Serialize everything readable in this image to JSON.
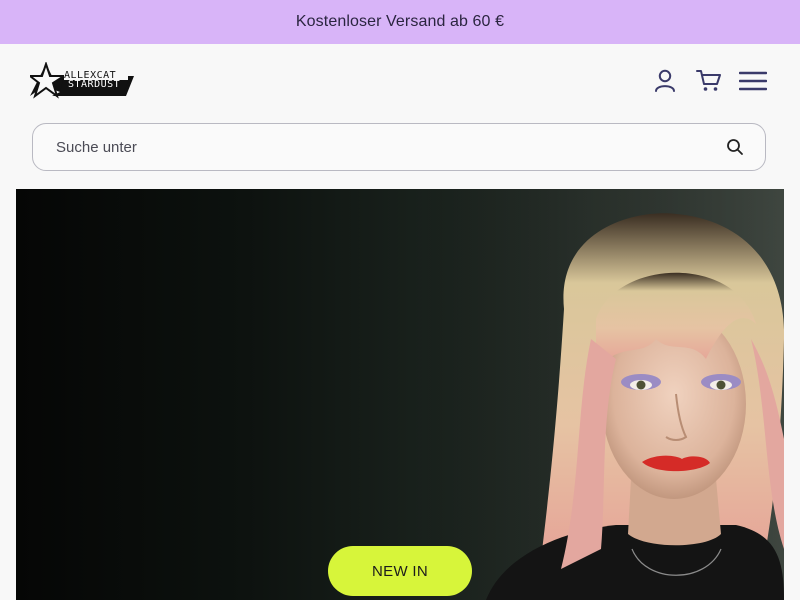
{
  "promo": {
    "text": "Kostenloser Versand ab 60 €"
  },
  "header": {
    "logo": {
      "line1": "ALLEXCAT",
      "line2": "STARDUST"
    },
    "icons": {
      "account": "user-icon",
      "cart": "cart-icon",
      "menu": "hamburger-menu-icon"
    }
  },
  "search": {
    "placeholder": "Suche unter",
    "icon": "search-icon"
  },
  "hero": {
    "cta_label": "NEW IN"
  },
  "colors": {
    "promo_bg": "#d8b4f8",
    "cta_bg": "#d7f53a",
    "icon_color": "#3a3a6a",
    "page_bg": "#f8f8f8"
  }
}
